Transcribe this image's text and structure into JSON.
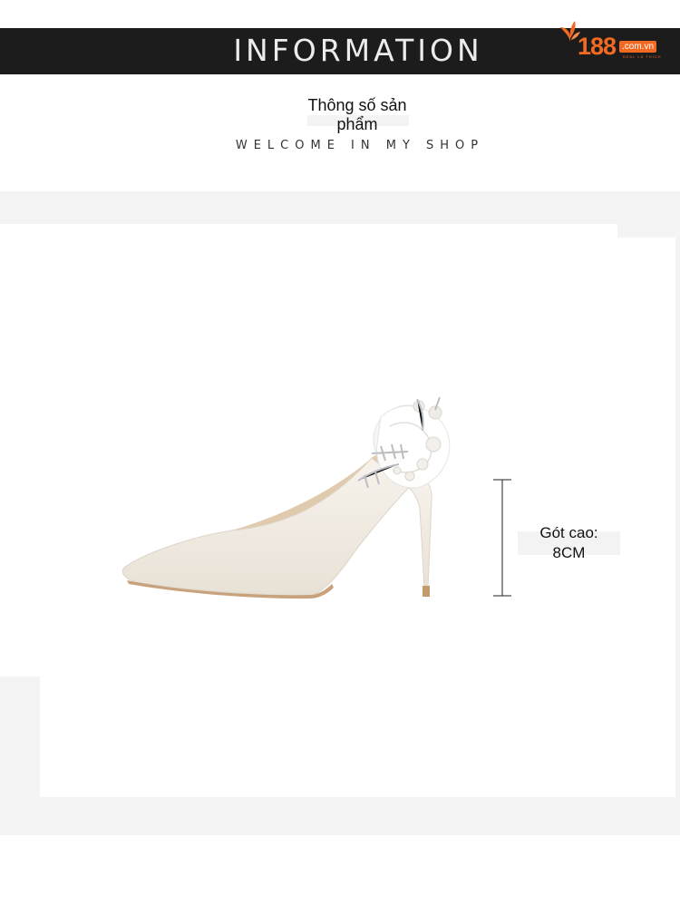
{
  "header": {
    "title": "INFORMATION",
    "logo": {
      "number": "188",
      "domain": ".com.vn",
      "tagline": "DEAL LÀ THÍCH",
      "color": "#f26a21"
    }
  },
  "intro": {
    "title_line1": "Thông số sản",
    "title_line2": "phẩm",
    "welcome": "WELCOME IN MY SHOP"
  },
  "product": {
    "image": "white-pointed-high-heel-shoe",
    "heel_label_line1": "Gót cao:",
    "heel_label_line2": "8CM"
  },
  "colors": {
    "header_bg": "#1c1c1c",
    "band": "#f4f4f4",
    "accent": "#f26a21"
  }
}
